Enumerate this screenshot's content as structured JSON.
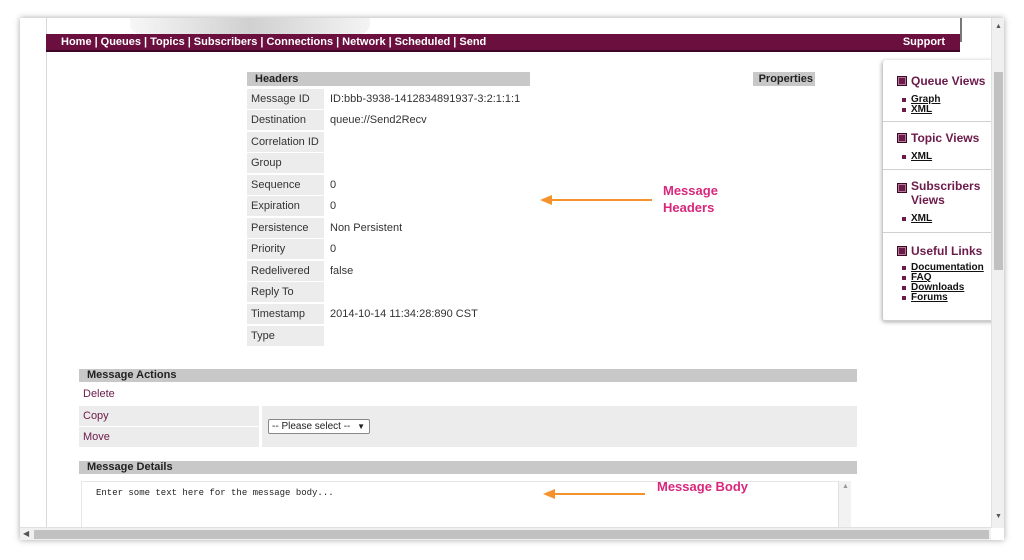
{
  "nav": {
    "items": [
      "Home",
      "Queues",
      "Topics",
      "Subscribers",
      "Connections",
      "Network",
      "Scheduled",
      "Send"
    ],
    "separator": "|",
    "support": "Support"
  },
  "headers": {
    "title": "Headers",
    "properties_title": "Properties",
    "rows": [
      {
        "label": "Message ID",
        "value": "ID:bbb-3938-1412834891937-3:2:1:1:1"
      },
      {
        "label": "Destination",
        "value": "queue://Send2Recv"
      },
      {
        "label": "Correlation ID",
        "value": ""
      },
      {
        "label": "Group",
        "value": ""
      },
      {
        "label": "Sequence",
        "value": "0"
      },
      {
        "label": "Expiration",
        "value": "0"
      },
      {
        "label": "Persistence",
        "value": "Non Persistent"
      },
      {
        "label": "Priority",
        "value": "0"
      },
      {
        "label": "Redelivered",
        "value": "false"
      },
      {
        "label": "Reply To",
        "value": ""
      },
      {
        "label": "Timestamp",
        "value": "2014-10-14 11:34:28:890 CST"
      },
      {
        "label": "Type",
        "value": ""
      }
    ]
  },
  "annotations": {
    "headers_line1": "Message",
    "headers_line2": "Headers",
    "body": "Message Body",
    "color": "#d9277d",
    "arrow_color": "#f5922b"
  },
  "actions": {
    "title": "Message Actions",
    "delete": "Delete",
    "copy": "Copy",
    "move": "Move",
    "select_value": "-- Please select --"
  },
  "details": {
    "title": "Message Details",
    "body_text": "Enter some text here for the message body..."
  },
  "sidebar": {
    "queue_title": "Queue Views",
    "queue_items": [
      "Graph",
      "XML"
    ],
    "topic_title": "Topic Views",
    "topic_items": [
      "XML"
    ],
    "subscribers_title_line1": "Subscribers",
    "subscribers_title_line2": "Views",
    "subscribers_items": [
      "XML"
    ],
    "useful_title": "Useful Links",
    "useful_items": [
      "Documentation",
      "FAQ",
      "Downloads",
      "Forums"
    ]
  },
  "colors": {
    "brand": "#6b0f3f",
    "link": "#6b1a4a",
    "section_bar": "#c8c8c8"
  }
}
